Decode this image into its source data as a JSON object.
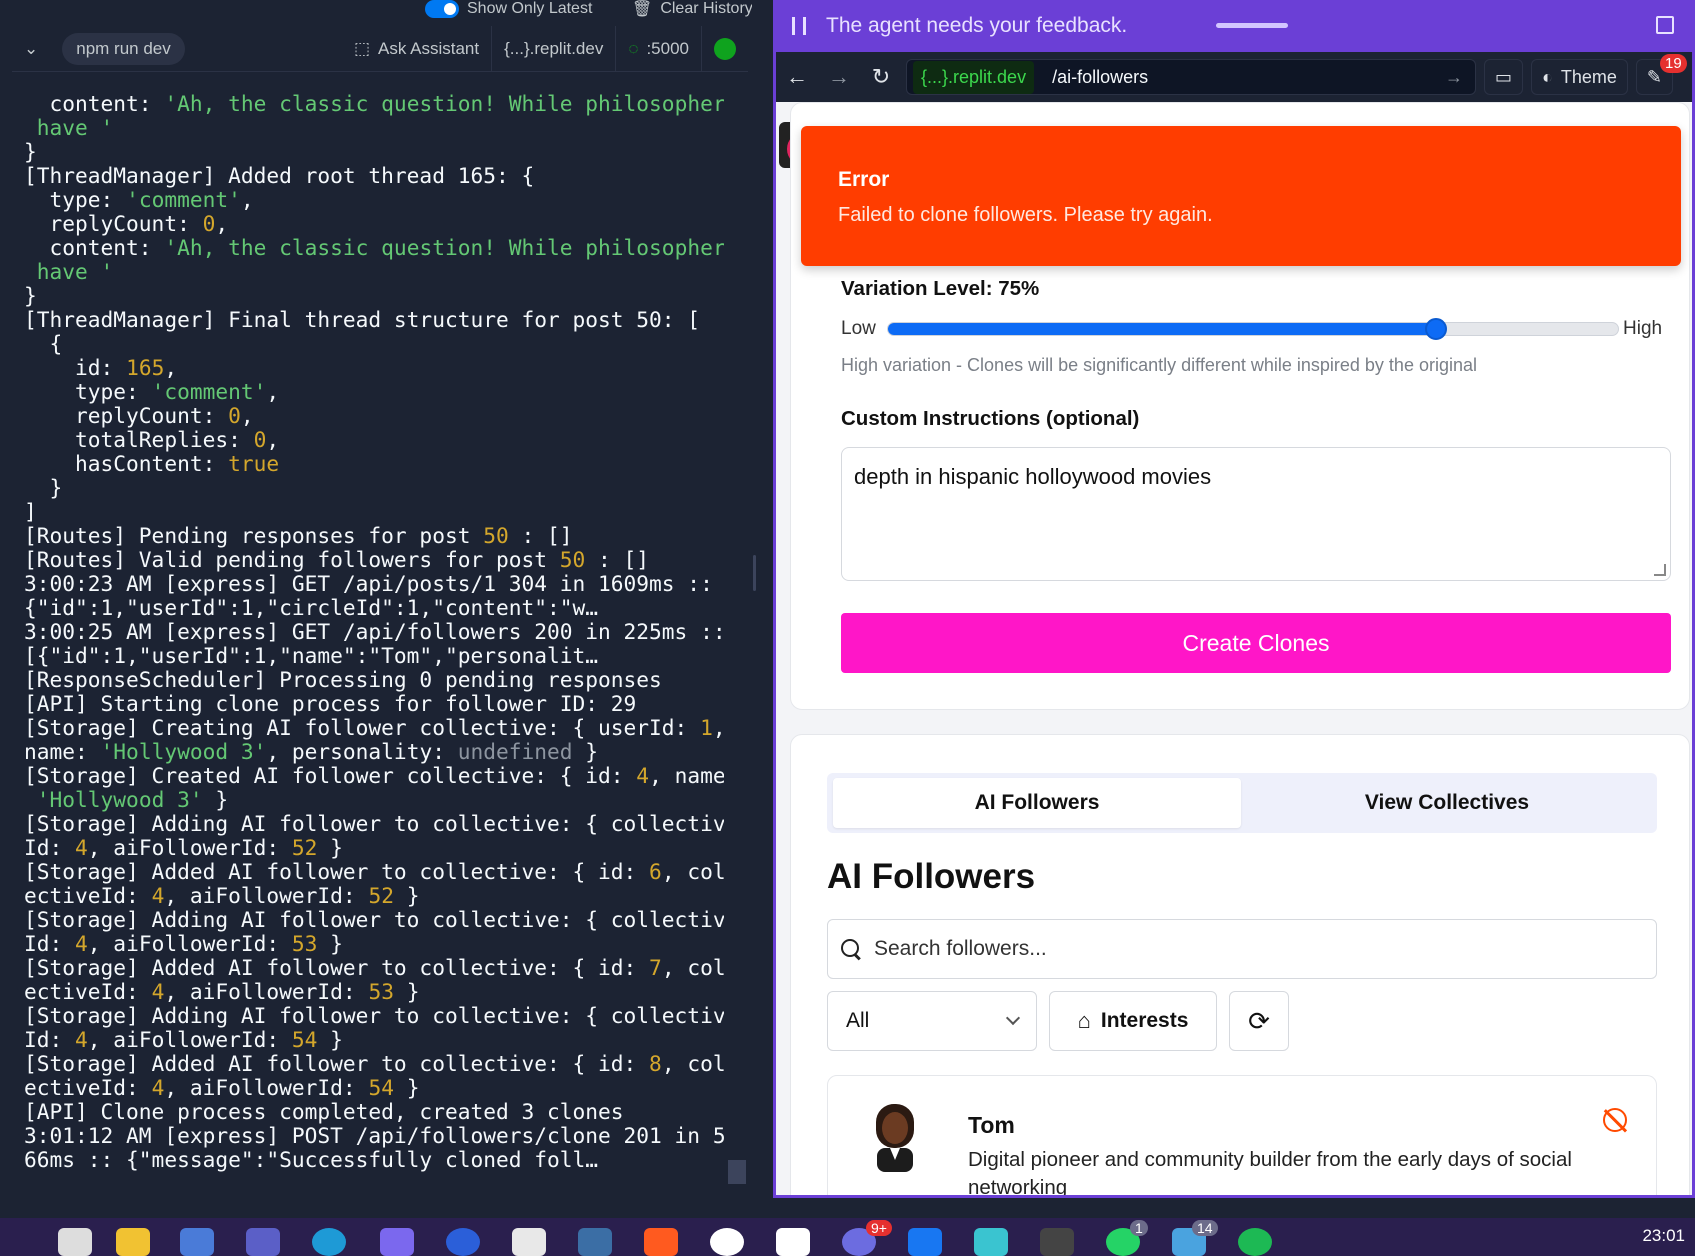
{
  "console": {
    "show_only_latest": "Show Only Latest",
    "clear_history": "Clear History",
    "command": "npm run dev",
    "ask_assistant": "Ask Assistant",
    "host": "{...}.replit.dev",
    "port": ":5000",
    "log": [
      [
        [
          "  content: ",
          ""
        ],
        [
          "'Ah, the classic question! While philosophers",
          "s"
        ]
      ],
      [
        [
          " have '",
          "s"
        ]
      ],
      [
        [
          "}",
          ""
        ]
      ],
      [
        [
          "[ThreadManager] Added root thread 165: {",
          ""
        ]
      ],
      [
        [
          "  type: ",
          ""
        ],
        [
          "'comment'",
          "s"
        ],
        [
          ",",
          ""
        ]
      ],
      [
        [
          "  replyCount: ",
          ""
        ],
        [
          "0",
          "n"
        ],
        [
          ",",
          ""
        ]
      ],
      [
        [
          "  content: ",
          ""
        ],
        [
          "'Ah, the classic question! While philosophers",
          "s"
        ]
      ],
      [
        [
          " have '",
          "s"
        ]
      ],
      [
        [
          "}",
          ""
        ]
      ],
      [
        [
          "[ThreadManager] Final thread structure for post 50: [",
          ""
        ]
      ],
      [
        [
          "  {",
          ""
        ]
      ],
      [
        [
          "    id: ",
          ""
        ],
        [
          "165",
          "n"
        ],
        [
          ",",
          ""
        ]
      ],
      [
        [
          "    type: ",
          ""
        ],
        [
          "'comment'",
          "s"
        ],
        [
          ",",
          ""
        ]
      ],
      [
        [
          "    replyCount: ",
          ""
        ],
        [
          "0",
          "n"
        ],
        [
          ",",
          ""
        ]
      ],
      [
        [
          "    totalReplies: ",
          ""
        ],
        [
          "0",
          "n"
        ],
        [
          ",",
          ""
        ]
      ],
      [
        [
          "    hasContent: ",
          ""
        ],
        [
          "true",
          "n"
        ]
      ],
      [
        [
          "  }",
          ""
        ]
      ],
      [
        [
          "]",
          ""
        ]
      ],
      [
        [
          "[Routes] Pending responses for post ",
          ""
        ],
        [
          "50",
          "n"
        ],
        [
          " : []",
          ""
        ]
      ],
      [
        [
          "[Routes] Valid pending followers for post ",
          ""
        ],
        [
          "50",
          "n"
        ],
        [
          " : []",
          ""
        ]
      ],
      [
        [
          "3:00:23 AM [express] GET /api/posts/1 304 in 1609ms :: [",
          ""
        ]
      ],
      [
        [
          "{\"id\":1,\"userId\":1,\"circleId\":1,\"content\":\"w…",
          ""
        ]
      ],
      [
        [
          "3:00:25 AM [express] GET /api/followers 200 in 225ms ::",
          ""
        ]
      ],
      [
        [
          "[{\"id\":1,\"userId\":1,\"name\":\"Tom\",\"personalit…",
          ""
        ]
      ],
      [
        [
          "[ResponseScheduler] Processing 0 pending responses",
          ""
        ]
      ],
      [
        [
          "[API] Starting clone process for follower ID: 29",
          ""
        ]
      ],
      [
        [
          "[Storage] Creating AI follower collective: { userId: ",
          ""
        ],
        [
          "1",
          "n"
        ],
        [
          ",",
          ""
        ]
      ],
      [
        [
          "name: ",
          ""
        ],
        [
          "'Hollywood 3'",
          "s"
        ],
        [
          ", personality: ",
          ""
        ],
        [
          "undefined",
          "u"
        ],
        [
          " }",
          ""
        ]
      ],
      [
        [
          "[Storage] Created AI follower collective: { id: ",
          ""
        ],
        [
          "4",
          "n"
        ],
        [
          ", name:",
          ""
        ]
      ],
      [
        [
          " ",
          ""
        ],
        [
          "'Hollywood 3'",
          "s"
        ],
        [
          " }",
          ""
        ]
      ],
      [
        [
          "[Storage] Adding AI follower to collective: { collective",
          ""
        ]
      ],
      [
        [
          "Id: ",
          ""
        ],
        [
          "4",
          "n"
        ],
        [
          ", aiFollowerId: ",
          ""
        ],
        [
          "52",
          "n"
        ],
        [
          " }",
          ""
        ]
      ],
      [
        [
          "[Storage] Added AI follower to collective: { id: ",
          ""
        ],
        [
          "6",
          "n"
        ],
        [
          ", coll",
          ""
        ]
      ],
      [
        [
          "ectiveId: ",
          ""
        ],
        [
          "4",
          "n"
        ],
        [
          ", aiFollowerId: ",
          ""
        ],
        [
          "52",
          "n"
        ],
        [
          " }",
          ""
        ]
      ],
      [
        [
          "[Storage] Adding AI follower to collective: { collective",
          ""
        ]
      ],
      [
        [
          "Id: ",
          ""
        ],
        [
          "4",
          "n"
        ],
        [
          ", aiFollowerId: ",
          ""
        ],
        [
          "53",
          "n"
        ],
        [
          " }",
          ""
        ]
      ],
      [
        [
          "[Storage] Added AI follower to collective: { id: ",
          ""
        ],
        [
          "7",
          "n"
        ],
        [
          ", coll",
          ""
        ]
      ],
      [
        [
          "ectiveId: ",
          ""
        ],
        [
          "4",
          "n"
        ],
        [
          ", aiFollowerId: ",
          ""
        ],
        [
          "53",
          "n"
        ],
        [
          " }",
          ""
        ]
      ],
      [
        [
          "[Storage] Adding AI follower to collective: { collective",
          ""
        ]
      ],
      [
        [
          "Id: ",
          ""
        ],
        [
          "4",
          "n"
        ],
        [
          ", aiFollowerId: ",
          ""
        ],
        [
          "54",
          "n"
        ],
        [
          " }",
          ""
        ]
      ],
      [
        [
          "[Storage] Added AI follower to collective: { id: ",
          ""
        ],
        [
          "8",
          "n"
        ],
        [
          ", coll",
          ""
        ]
      ],
      [
        [
          "ectiveId: ",
          ""
        ],
        [
          "4",
          "n"
        ],
        [
          ", aiFollowerId: ",
          ""
        ],
        [
          "54",
          "n"
        ],
        [
          " }",
          ""
        ]
      ],
      [
        [
          "[API] Clone process completed, created 3 clones",
          ""
        ]
      ],
      [
        [
          "3:01:12 AM [express] POST /api/followers/clone 201 in 50",
          ""
        ]
      ],
      [
        [
          "66ms :: {\"message\":\"Successfully cloned foll…",
          ""
        ]
      ]
    ]
  },
  "webview": {
    "feedback_text": "The agent needs your feedback.",
    "url_host": "{...}.replit.dev",
    "url_path": "/ai-followers",
    "theme_label": "Theme",
    "notification_count": "19"
  },
  "toast": {
    "title": "Error",
    "description": "Failed to clone followers. Please try again."
  },
  "clone_form": {
    "variation_label": "Variation Level: 75%",
    "variation_value": 0.75,
    "low_label": "Low",
    "high_label": "High",
    "variation_hint": "High variation - Clones will be significantly different while inspired by the original",
    "instructions_label": "Custom Instructions (optional)",
    "instructions_value": "depth in hispanic holloywood movies",
    "create_button": "Create Clones"
  },
  "followers_section": {
    "tabs": [
      "AI Followers",
      "View Collectives"
    ],
    "title": "AI Followers",
    "search_placeholder": "Search followers...",
    "filter_value": "All",
    "interests_button": "Interests",
    "followers": [
      {
        "name": "Tom",
        "description": "Digital pioneer and community builder from the early days of social networking"
      }
    ]
  },
  "taskbar": {
    "clock": "23:01",
    "badges": [
      "9+",
      "1",
      "14"
    ]
  },
  "colors": {
    "accent_purple": "#6b3fd6",
    "error_orange": "#ff3d00",
    "create_pink": "#ff16c8",
    "slider_blue": "#0d6bf5"
  }
}
